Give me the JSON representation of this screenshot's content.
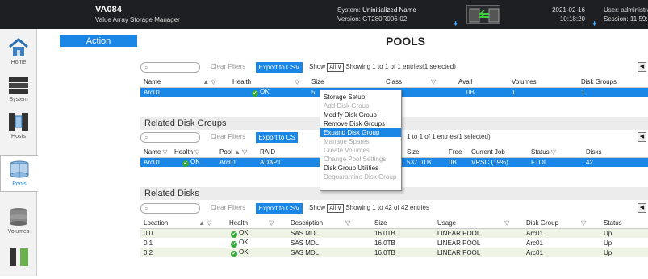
{
  "header": {
    "title": "VA084",
    "subtitle": "Value Array Storage Manager",
    "system_label": "System:",
    "system_value": "Uninitialized Name",
    "version_label": "Version:",
    "version_value": "GT280R006-02",
    "date": "2021-02-16",
    "time": "10:18:20",
    "user_label": "User:",
    "user_value": "administrator",
    "session_label": "Session:",
    "session_value": "11:59:50"
  },
  "sidebar": {
    "items": [
      {
        "label": "Home",
        "icon": "home-icon"
      },
      {
        "label": "System",
        "icon": "system-icon"
      },
      {
        "label": "Hosts",
        "icon": "hosts-icon"
      },
      {
        "label": "Pools",
        "icon": "pools-icon"
      },
      {
        "label": "Volumes",
        "icon": "volumes-icon"
      },
      {
        "label": "",
        "icon": "mappings-icon"
      }
    ]
  },
  "action_label": "Action",
  "page_title": "POOLS",
  "pools": {
    "clear_filters": "Clear Filters",
    "export": "Export to CSV",
    "show": "Show",
    "show_value": "All",
    "showing": "Showing 1 to 1 of 1 entries(1 selected)",
    "columns": [
      "Name",
      "Health",
      "Size",
      "Class",
      "Avail",
      "Volumes",
      "Disk Groups"
    ],
    "rows": [
      {
        "name": "Arc01",
        "health": "OK",
        "size": "5",
        "class": "r",
        "avail": "0B",
        "volumes": "1",
        "disk_groups": "1"
      }
    ]
  },
  "disk_groups": {
    "section_title": "Related Disk Groups",
    "clear_filters": "Clear Filters",
    "export": "Export to CS",
    "showing": "1 to 1 of 1 entries(1 selected)",
    "columns": [
      "Name",
      "Health",
      "Pool",
      "RAID",
      "ption",
      "Size",
      "Free",
      "Current Job",
      "Status",
      "Disks"
    ],
    "rows": [
      {
        "name": "Arc01",
        "health": "OK",
        "pool": "Arc01",
        "raid": "ADAPT",
        "size": "537.0TB",
        "free": "0B",
        "job": "VRSC (19%)",
        "status": "FTOL",
        "disks": "42"
      }
    ]
  },
  "disks": {
    "section_title": "Related Disks",
    "clear_filters": "Clear Filters",
    "export": "Export to CSV",
    "show": "Show",
    "show_value": "All",
    "showing": "Showing 1 to 42 of 42 entries",
    "columns": [
      "Location",
      "Health",
      "Description",
      "Size",
      "Usage",
      "Disk Group",
      "Status"
    ],
    "rows": [
      {
        "location": "0.0",
        "health": "OK",
        "description": "SAS MDL",
        "size": "16.0TB",
        "usage": "LINEAR POOL",
        "group": "Arc01",
        "status": "Up"
      },
      {
        "location": "0.1",
        "health": "OK",
        "description": "SAS MDL",
        "size": "16.0TB",
        "usage": "LINEAR POOL",
        "group": "Arc01",
        "status": "Up"
      },
      {
        "location": "0.2",
        "health": "OK",
        "description": "SAS MDL",
        "size": "16.0TB",
        "usage": "LINEAR POOL",
        "group": "Arc01",
        "status": "Up"
      }
    ]
  },
  "context_menu": {
    "items": [
      {
        "label": "Storage Setup",
        "state": "enabled"
      },
      {
        "label": "Add Disk Group",
        "state": "disabled"
      },
      {
        "label": "Modify Disk Group",
        "state": "enabled"
      },
      {
        "label": "Remove Disk Groups",
        "state": "enabled"
      },
      {
        "label": "Expand Disk Group",
        "state": "highlighted"
      },
      {
        "label": "Manage Spares",
        "state": "disabled"
      },
      {
        "label": "Create Volumes",
        "state": "disabled"
      },
      {
        "label": "Change Pool Settings",
        "state": "disabled"
      },
      {
        "label": "Disk Group Utilities",
        "state": "enabled"
      },
      {
        "label": "Dequarantine Disk Group",
        "state": "disabled"
      }
    ]
  },
  "colors": {
    "accent": "#1a86e6",
    "header_bg": "#1d1f22",
    "ok": "#35a83a"
  }
}
